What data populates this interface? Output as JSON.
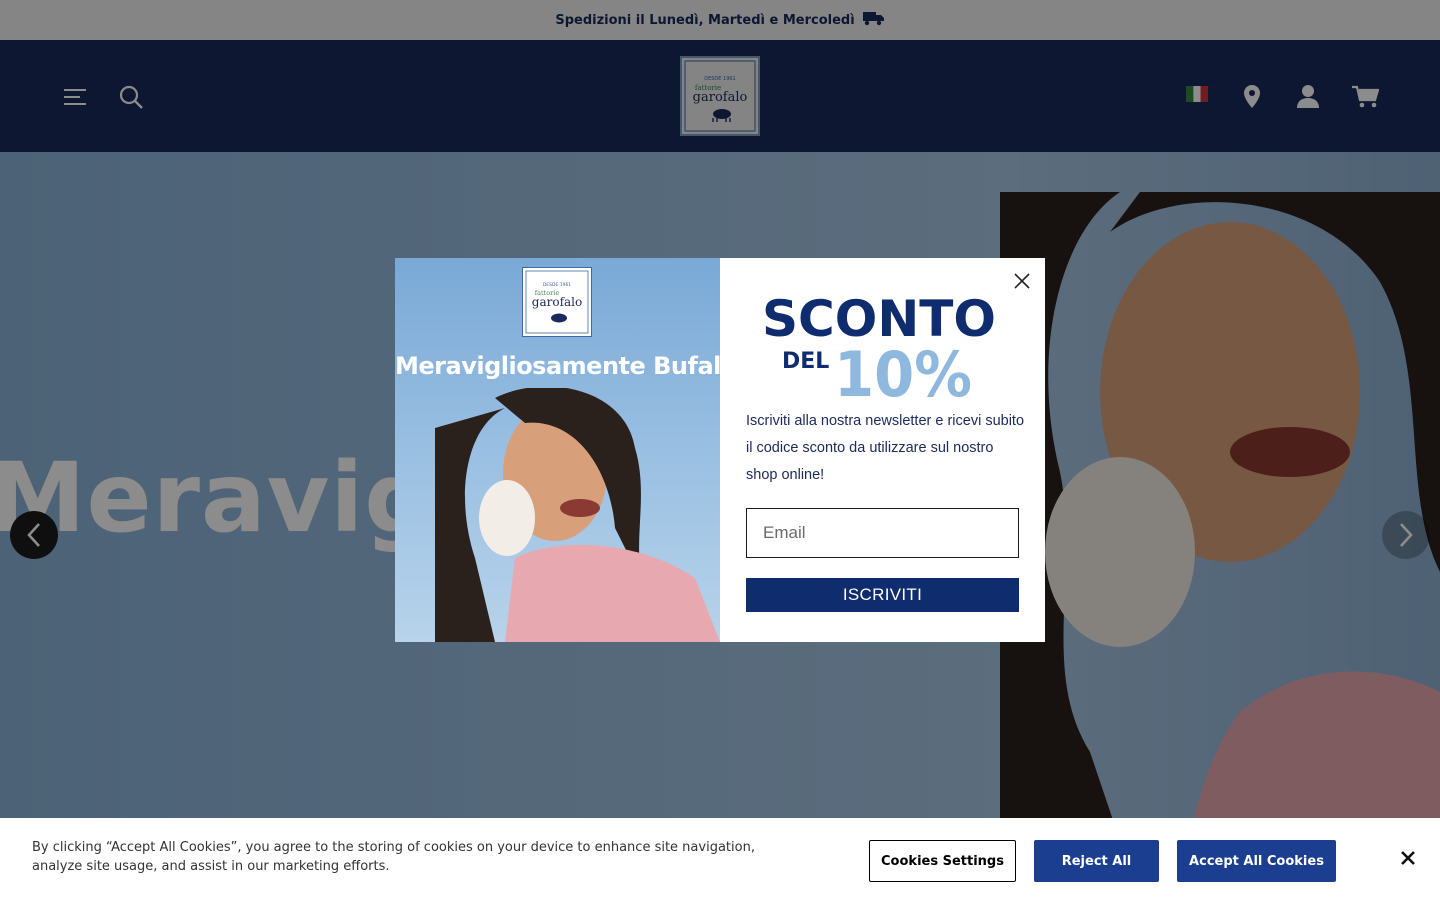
{
  "announcement": {
    "text": "Spedizioni il Lunedì, Martedì e Mercoledì",
    "icon": "truck-icon"
  },
  "header": {
    "logo_top": "DESDE 1961",
    "logo_small": "fattorie",
    "logo_main": "garofalo",
    "icons": [
      "menu-icon",
      "search-icon",
      "italy-flag-icon",
      "location-pin-icon",
      "account-icon",
      "cart-icon"
    ]
  },
  "hero": {
    "text": "Meravigliosamente"
  },
  "modal": {
    "image_title": "Meravigliosamente Bufala",
    "headline_1": "SCONTO",
    "headline_2": "DEL",
    "headline_3": "10%",
    "description": "Iscriviti alla nostra newsletter e ricevi subito il codice sconto da utilizzare sul nostro shop online!",
    "email_placeholder": "Email",
    "submit_label": "ISCRIVITI"
  },
  "cookie_banner": {
    "text": "By clicking “Accept All Cookies”, you agree to the storing of cookies on your device to enhance site navigation, analyze site usage, and assist in our marketing efforts.",
    "settings_label": "Cookies Settings",
    "reject_label": "Reject All",
    "accept_label": "Accept All Cookies"
  },
  "colors": {
    "navy": "#1b2a5c",
    "button_blue": "#1c3e91",
    "iscriviti_blue": "#0f2c6e",
    "accent_light_blue": "#8fb8de"
  }
}
